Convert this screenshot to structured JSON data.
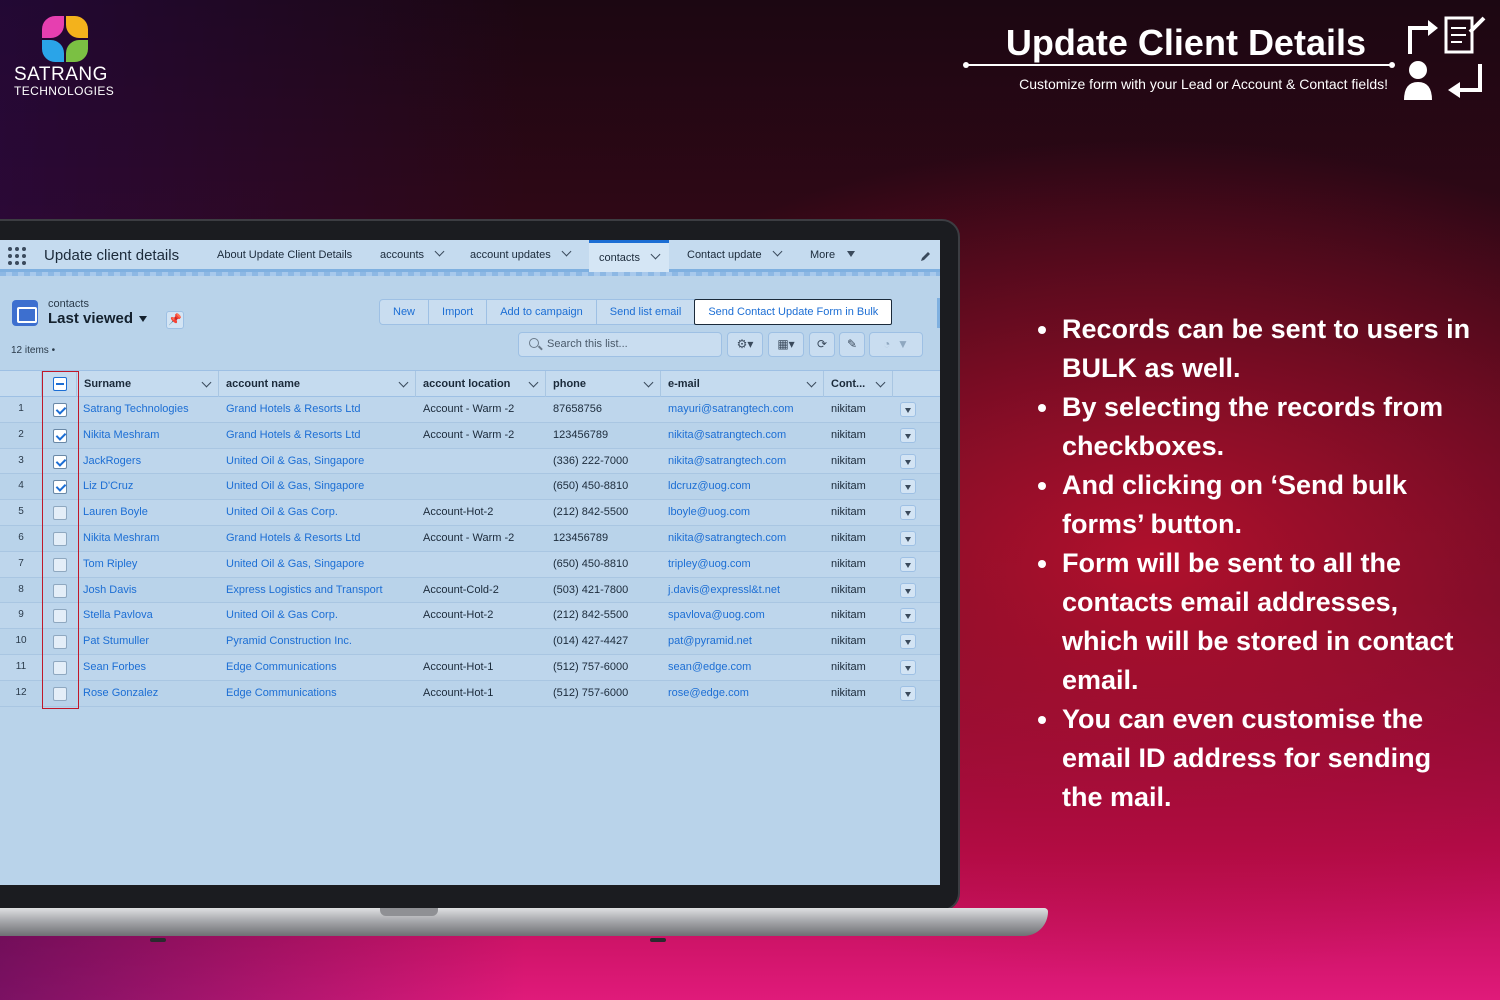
{
  "brand": {
    "name": "SATRANG",
    "sub": "TECHNOLOGIES"
  },
  "hero": {
    "title": "Update Client Details",
    "subtitle": "Customize form with your Lead or Account & Contact fields!"
  },
  "bullets": [
    "Records can be sent to users in BULK as well.",
    "By selecting the records from checkboxes.",
    "And clicking on ‘Send bulk forms’ button.",
    "Form will be sent to all the contacts email addresses, which will be stored in contact email.",
    "You can even customise the email ID address for sending the mail."
  ],
  "app": {
    "name": "Update client details",
    "nav": {
      "about": "About Update Client Details",
      "accounts": "accounts",
      "account_updates": "account updates",
      "contacts": "contacts",
      "contact_update": "Contact update",
      "more": "More"
    }
  },
  "list": {
    "object": "contacts",
    "view": "Last viewed",
    "count": "12 items •",
    "search_placeholder": "Search this list...",
    "buttons": {
      "new": "New",
      "import": "Import",
      "add_campaign": "Add to campaign",
      "send_email": "Send list email",
      "send_bulk": "Send Contact Update Form in Bulk"
    },
    "columns": {
      "surname": "Surname",
      "account_name": "account name",
      "account_location": "account location",
      "phone": "phone",
      "email": "e-mail",
      "owner": "Cont..."
    },
    "rows": [
      {
        "n": "1",
        "checked": true,
        "surname": "Satrang Technologies",
        "account": "Grand Hotels & Resorts Ltd",
        "location": "Account - Warm -2",
        "phone": "87658756",
        "email": "mayuri@satrangtech.com",
        "owner": "nikitam"
      },
      {
        "n": "2",
        "checked": true,
        "surname": "Nikita Meshram",
        "account": "Grand Hotels & Resorts Ltd",
        "location": "Account - Warm -2",
        "phone": "123456789",
        "email": "nikita@satrangtech.com",
        "owner": "nikitam"
      },
      {
        "n": "3",
        "checked": true,
        "surname": "JackRogers",
        "account": "United Oil & Gas, Singapore",
        "location": "",
        "phone": "(336) 222-7000",
        "email": "nikita@satrangtech.com",
        "owner": "nikitam"
      },
      {
        "n": "4",
        "checked": true,
        "surname": "Liz D'Cruz",
        "account": "United Oil & Gas, Singapore",
        "location": "",
        "phone": "(650) 450-8810",
        "email": "ldcruz@uog.com",
        "owner": "nikitam"
      },
      {
        "n": "5",
        "checked": false,
        "surname": "Lauren Boyle",
        "account": "United Oil & Gas Corp.",
        "location": "Account-Hot-2",
        "phone": "(212) 842-5500",
        "email": "lboyle@uog.com",
        "owner": "nikitam"
      },
      {
        "n": "6",
        "checked": false,
        "surname": "Nikita Meshram",
        "account": "Grand Hotels & Resorts Ltd",
        "location": "Account - Warm -2",
        "phone": "123456789",
        "email": "nikita@satrangtech.com",
        "owner": "nikitam"
      },
      {
        "n": "7",
        "checked": false,
        "surname": "Tom Ripley",
        "account": "United Oil & Gas, Singapore",
        "location": "",
        "phone": "(650) 450-8810",
        "email": "tripley@uog.com",
        "owner": "nikitam"
      },
      {
        "n": "8",
        "checked": false,
        "surname": "Josh Davis",
        "account": "Express Logistics and Transport",
        "location": "Account-Cold-2",
        "phone": "(503) 421-7800",
        "email": "j.davis@expressl&t.net",
        "owner": "nikitam"
      },
      {
        "n": "9",
        "checked": false,
        "surname": "Stella Pavlova",
        "account": "United Oil & Gas Corp.",
        "location": "Account-Hot-2",
        "phone": "(212) 842-5500",
        "email": "spavlova@uog.com",
        "owner": "nikitam"
      },
      {
        "n": "10",
        "checked": false,
        "surname": "Pat Stumuller",
        "account": "Pyramid Construction Inc.",
        "location": "",
        "phone": "(014) 427-4427",
        "email": "pat@pyramid.net",
        "owner": "nikitam"
      },
      {
        "n": "11",
        "checked": false,
        "surname": "Sean Forbes",
        "account": "Edge Communications",
        "location": "Account-Hot-1",
        "phone": "(512) 757-6000",
        "email": "sean@edge.com",
        "owner": "nikitam"
      },
      {
        "n": "12",
        "checked": false,
        "surname": "Rose Gonzalez",
        "account": "Edge Communications",
        "location": "Account-Hot-1",
        "phone": "(512) 757-6000",
        "email": "rose@edge.com",
        "owner": "nikitam"
      }
    ]
  },
  "colors": {
    "accent": "#1c6ed4",
    "highlight_frame": "#c0182a"
  }
}
